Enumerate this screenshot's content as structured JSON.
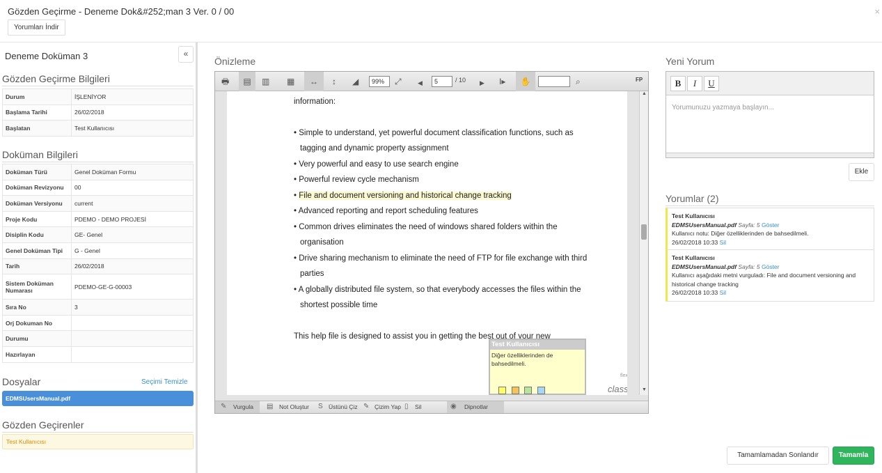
{
  "header": {
    "title": "Gözden Geçirme - Deneme Dok&#252;man 3 Ver. 0 / 00",
    "download_label": "Yorumları İndir",
    "close": "×"
  },
  "left": {
    "doc_title": "Deneme Doküman 3",
    "collapse": "«",
    "review_info_title": "Gözden Geçirme Bilgileri",
    "review_info": [
      {
        "k": "Durum",
        "v": "İŞLENİYOR"
      },
      {
        "k": "Başlama Tarihi",
        "v": "26/02/2018"
      },
      {
        "k": "Başlatan",
        "v": "Test Kullanıcısı"
      }
    ],
    "doc_info_title": "Doküman Bilgileri",
    "doc_info": [
      {
        "k": "Doküman Türü",
        "v": "Genel Doküman Formu"
      },
      {
        "k": "Doküman Revizyonu",
        "v": "00"
      },
      {
        "k": "Doküman Versiyonu",
        "v": "current"
      },
      {
        "k": "Proje Kodu",
        "v": "PDEMO - DEMO PROJESİ"
      },
      {
        "k": "Disiplin Kodu",
        "v": "GE- Genel"
      },
      {
        "k": "Genel Doküman Tipi",
        "v": "G - Genel"
      },
      {
        "k": "Tarih",
        "v": "26/02/2018"
      },
      {
        "k": "Sistem Doküman Numarası",
        "v": "PDEMO-GE-G-00003"
      },
      {
        "k": "Sıra No",
        "v": "3"
      },
      {
        "k": "Orj Dokuman No",
        "v": ""
      },
      {
        "k": "Durumu",
        "v": ""
      },
      {
        "k": "Hazırlayan",
        "v": ""
      }
    ],
    "files_title": "Dosyalar",
    "clear_label": "Seçimi Temizle",
    "file": "EDMSUsersManual.pdf",
    "reviewers_title": "Gözden Geçirenler",
    "reviewer": "Test Kullanıcısı"
  },
  "preview": {
    "title": "Önizleme",
    "zoom": "99%",
    "page": "5",
    "page_total": "/ 10",
    "fp": "FP",
    "lines": [
      "information:",
      "• Simple to understand, yet powerful document classification functions, such as",
      "tagging and dynamic property assignment",
      "• Very powerful and easy to use search engine",
      "• Powerful review cycle mechanism",
      "• ",
      "File and document versioning and historical change tracking",
      "• Advanced reporting and report scheduling features",
      "• Common drives eliminates the need of windows shared folders within the",
      "organisation",
      "• Drive sharing mechanism to eliminate the need of FTP for file exchange with third",
      "parties",
      "• A globally distributed file system, so that everybody accesses the files within the",
      "shortest possible time",
      "This help file is designed to assist you in getting the best out of your new"
    ],
    "note": {
      "user": "Test Kullanıcısı",
      "text": "Diğer özelliklerinden de bahsedilmeli."
    },
    "brand_small": "flexpaper",
    "brand": "classic",
    "bottom": {
      "highlight": "Vurgula",
      "note": "Not Oluştur",
      "strike": "Üstünü Çiz",
      "draw": "Çizim Yap",
      "delete": "Sil",
      "footnotes": "Dipnotlar"
    }
  },
  "right": {
    "new_comment_title": "Yeni Yorum",
    "bold": "B",
    "italic": "I",
    "underline": "U",
    "placeholder": "Yorumunuzu yazmaya başlayın...",
    "add_label": "Ekle",
    "comments_title": "Yorumlar (2)",
    "comments": [
      {
        "user": "Test Kullanıcısı",
        "file": "EDMSUsersManual.pdf",
        "page": "Sayfa: 5",
        "show": "Göster",
        "text": "Kullanıcı notu: Diğer özelliklerinden de bahsedilmeli.",
        "date": "26/02/2018 10:33",
        "delete": "Sil"
      },
      {
        "user": "Test Kullanıcısı",
        "file": "EDMSUsersManual.pdf",
        "page": "Sayfa: 5",
        "show": "Göster",
        "text": "Kullanıcı aşağıdaki metni vurguladı: File and document versioning and historical change tracking",
        "date": "26/02/2018 10:33",
        "delete": "Sil"
      }
    ]
  },
  "footer": {
    "finish_without": "Tamamlamadan Sonlandır",
    "complete": "Tamamla"
  },
  "colors": {
    "primary": "#4a8fd9",
    "success": "#2fb55c",
    "note": "#f1e64a"
  }
}
